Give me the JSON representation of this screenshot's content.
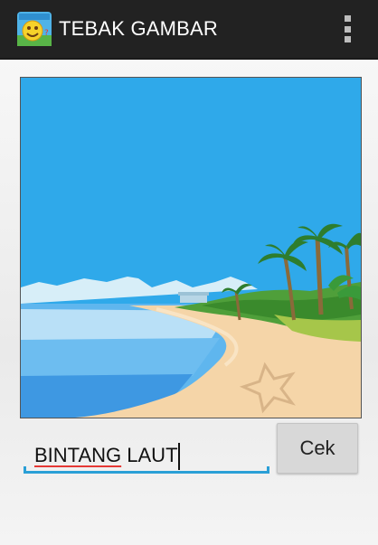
{
  "action_bar": {
    "title": "TEBAK GAMBAR",
    "background": "#222222",
    "app_icon": "smiley-app-icon",
    "overflow_icon": "overflow-menu-icon"
  },
  "puzzle_image": {
    "depicts": "beach-starfish-scene",
    "colors": {
      "sky": "#2fa9ea",
      "sand": "#f5d5a8",
      "sea": "#3f9de6",
      "palm": "#2e8b2e"
    }
  },
  "answer": {
    "first_word": "BINTANG",
    "second_word": " LAUT",
    "underline_color": "#2a9fd6"
  },
  "check_button": {
    "label": "Cek"
  }
}
